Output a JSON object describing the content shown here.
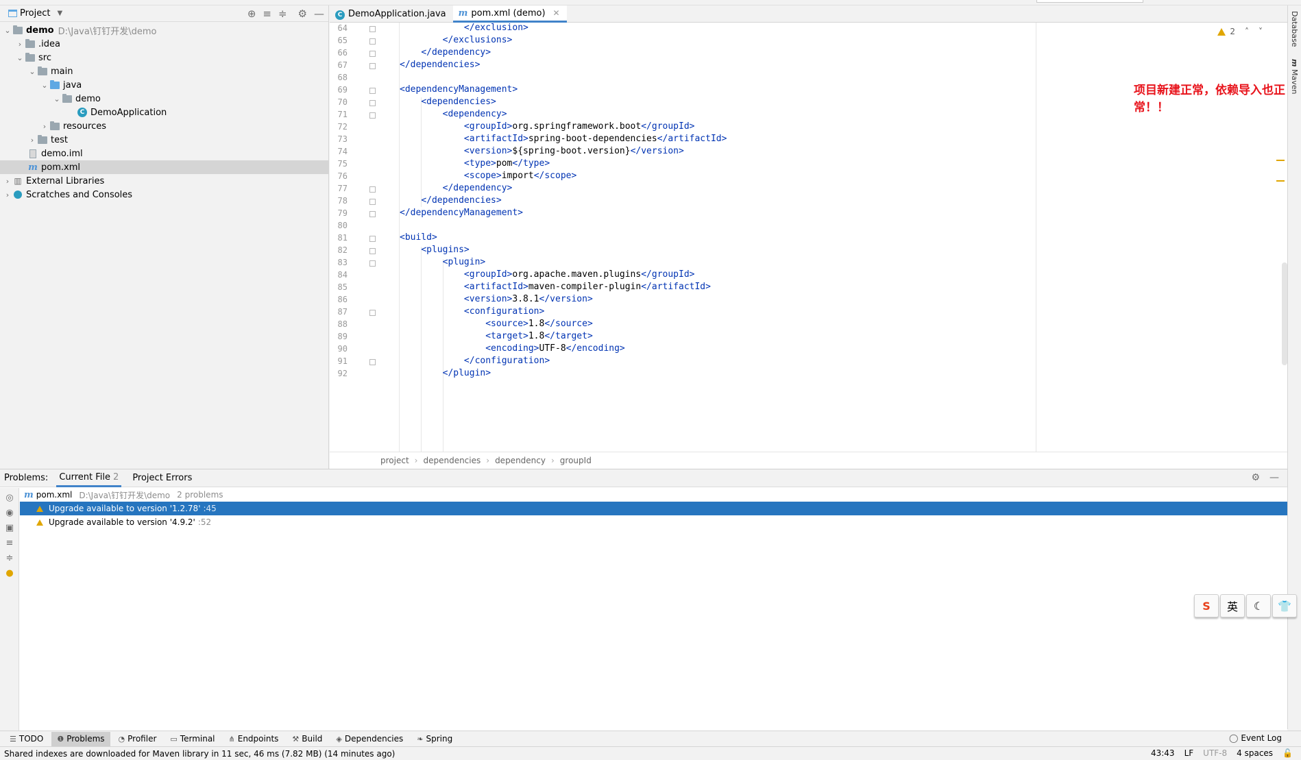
{
  "project_panel": {
    "title": "Project",
    "tree": [
      {
        "label": "demo",
        "path": "D:\\Java\\钉钉开发\\demo",
        "arrow": "⌄"
      },
      {
        "label": ".idea",
        "arrow": "›"
      },
      {
        "label": "src",
        "arrow": "⌄"
      },
      {
        "label": "main",
        "arrow": "⌄"
      },
      {
        "label": "java",
        "arrow": "⌄"
      },
      {
        "label": "demo",
        "arrow": "⌄"
      },
      {
        "label": "DemoApplication",
        "arrow": ""
      },
      {
        "label": "resources",
        "arrow": "›"
      },
      {
        "label": "test",
        "arrow": "›"
      },
      {
        "label": "demo.iml",
        "arrow": ""
      },
      {
        "label": "pom.xml",
        "arrow": ""
      },
      {
        "label": "External Libraries",
        "arrow": "›"
      },
      {
        "label": "Scratches and Consoles",
        "arrow": "›"
      }
    ]
  },
  "editor_tabs": [
    {
      "label": "DemoApplication.java"
    },
    {
      "label": "pom.xml (demo)"
    }
  ],
  "editor": {
    "line_numbers": [
      "64",
      "65",
      "66",
      "67",
      "68",
      "69",
      "70",
      "71",
      "72",
      "73",
      "74",
      "75",
      "76",
      "77",
      "78",
      "79",
      "80",
      "81",
      "82",
      "83",
      "84",
      "85",
      "86",
      "87",
      "88",
      "89",
      "90",
      "91",
      "92"
    ],
    "annotation": "项目新建正常，依赖导入也正常！！",
    "warning_count": "2",
    "breadcrumbs": [
      "project",
      "dependencies",
      "dependency",
      "groupId"
    ]
  },
  "right_strip": {
    "database": "Database",
    "maven": "Maven"
  },
  "problems": {
    "label": "Problems:",
    "tabs": [
      {
        "label": "Current File",
        "count": "2"
      },
      {
        "label": "Project Errors",
        "count": ""
      }
    ],
    "file": {
      "name": "pom.xml",
      "path": "D:\\Java\\钉钉开发\\demo",
      "summary": "2 problems"
    },
    "items": [
      {
        "text": "Upgrade available to version '1.2.78'",
        "line": ":45"
      },
      {
        "text": "Upgrade available to version '4.9.2'",
        "line": ":52"
      }
    ]
  },
  "ime": {
    "lang": "英"
  },
  "toolbar": {
    "items": [
      "TODO",
      "Problems",
      "Profiler",
      "Terminal",
      "Endpoints",
      "Build",
      "Dependencies",
      "Spring"
    ],
    "event_log": "Event Log"
  },
  "statusbar": {
    "message": "Shared indexes are downloaded for Maven library in 11 sec, 46 ms (7.82 MB) (14 minutes ago)",
    "position": "43:43",
    "line_sep": "LF",
    "encoding": "UTF-8",
    "indent": "4 spaces"
  },
  "colors": {
    "accent": "#4083c9",
    "selection": "#2675bf",
    "annotation": "#e8141c",
    "tag": "#0033b3",
    "warning": "#e0a600"
  }
}
